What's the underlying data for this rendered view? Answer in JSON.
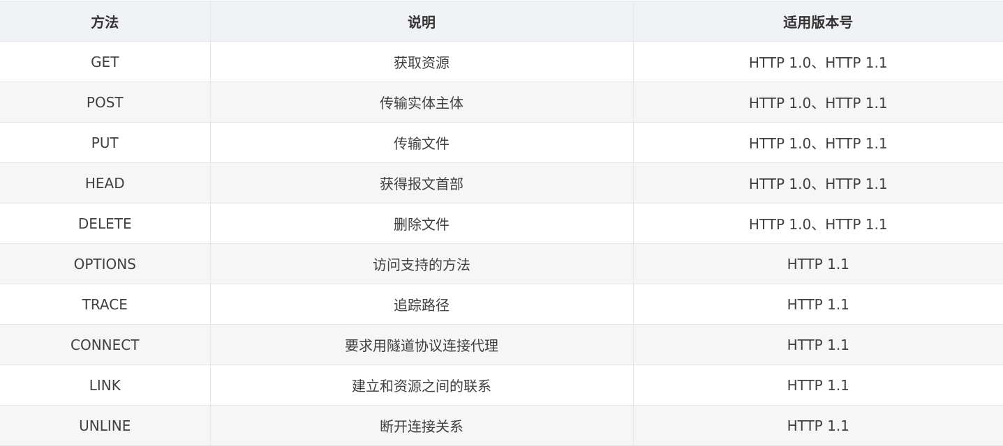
{
  "table": {
    "headers": [
      "方法",
      "说明",
      "适用版本号"
    ],
    "rows": [
      {
        "method": "GET",
        "description": "获取资源",
        "versions": "HTTP 1.0、HTTP 1.1"
      },
      {
        "method": "POST",
        "description": "传输实体主体",
        "versions": "HTTP 1.0、HTTP 1.1"
      },
      {
        "method": "PUT",
        "description": "传输文件",
        "versions": "HTTP 1.0、HTTP 1.1"
      },
      {
        "method": "HEAD",
        "description": "获得报文首部",
        "versions": "HTTP 1.0、HTTP 1.1"
      },
      {
        "method": "DELETE",
        "description": "删除文件",
        "versions": "HTTP 1.0、HTTP 1.1"
      },
      {
        "method": "OPTIONS",
        "description": "访问支持的方法",
        "versions": "HTTP 1.1"
      },
      {
        "method": "TRACE",
        "description": "追踪路径",
        "versions": "HTTP 1.1"
      },
      {
        "method": "CONNECT",
        "description": "要求用隧道协议连接代理",
        "versions": "HTTP 1.1"
      },
      {
        "method": "LINK",
        "description": "建立和资源之间的联系",
        "versions": "HTTP 1.1"
      },
      {
        "method": "UNLINE",
        "description": "断开连接关系",
        "versions": "HTTP 1.1"
      }
    ]
  },
  "colors": {
    "header_bg": "#f0f2f5",
    "stripe_bg": "#f6f6f6",
    "border": "#e4e7ec",
    "text": "#404040"
  }
}
